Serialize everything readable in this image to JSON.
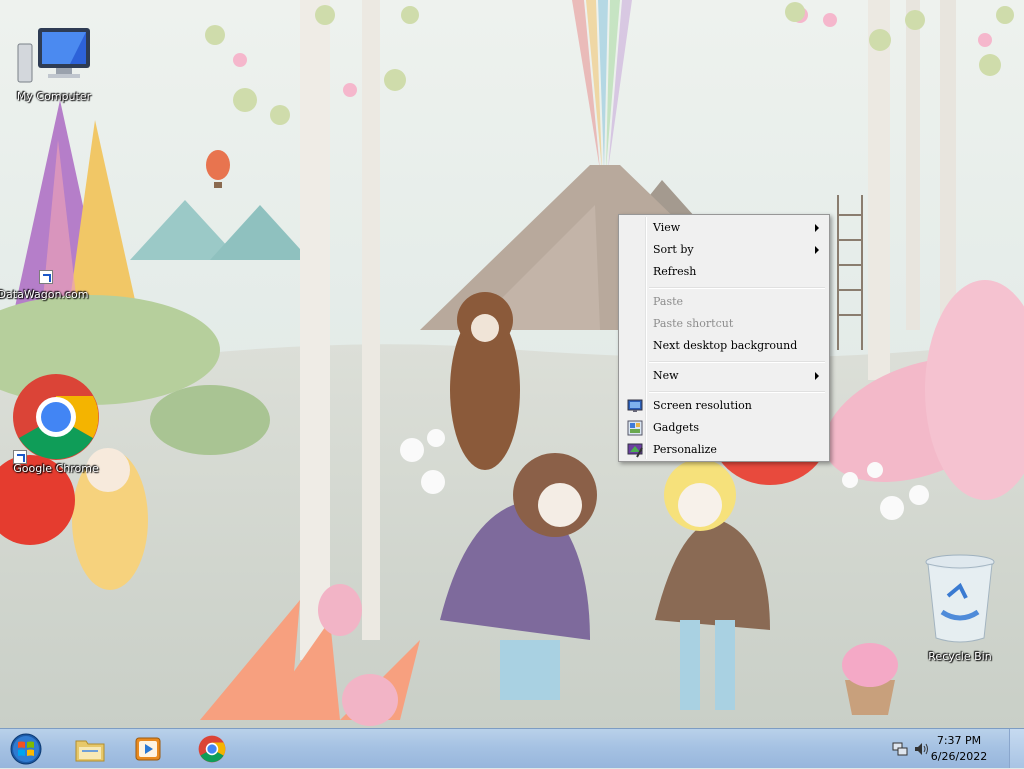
{
  "desktop": {
    "icons": [
      {
        "label": "My Computer",
        "icon": "computer-icon"
      },
      {
        "label": "DataWagon.com",
        "icon": "shortcut-icon"
      },
      {
        "label": "Google Chrome",
        "icon": "chrome-icon"
      },
      {
        "label": "Recycle Bin",
        "icon": "recycle-bin-icon"
      }
    ]
  },
  "context_menu": {
    "items": [
      {
        "label": "View",
        "submenu": true,
        "enabled": true
      },
      {
        "label": "Sort by",
        "submenu": true,
        "enabled": true
      },
      {
        "label": "Refresh",
        "enabled": true
      },
      {
        "label": "Paste",
        "enabled": false
      },
      {
        "label": "Paste shortcut",
        "enabled": false
      },
      {
        "label": "Next desktop background",
        "enabled": true
      },
      {
        "label": "New",
        "submenu": true,
        "enabled": true
      },
      {
        "label": "Screen resolution",
        "icon": "display-icon",
        "enabled": true
      },
      {
        "label": "Gadgets",
        "icon": "gadgets-icon",
        "enabled": true
      },
      {
        "label": "Personalize",
        "icon": "personalize-icon",
        "enabled": true
      }
    ]
  },
  "taskbar": {
    "pinned": [
      {
        "name": "Windows Explorer",
        "icon": "folder-icon"
      },
      {
        "name": "Windows Media Player",
        "icon": "media-player-icon"
      },
      {
        "name": "Google Chrome",
        "icon": "chrome-icon"
      }
    ],
    "tray": {
      "icons": [
        "network-icon",
        "volume-icon"
      ],
      "time": "7:37 PM",
      "date": "6/26/2022"
    }
  },
  "colors": {
    "taskbar": "#a6c2e3",
    "menu_background": "#f0f0f0",
    "chrome_red": "#db4437",
    "chrome_yellow": "#f4b400",
    "chrome_green": "#0f9d58",
    "chrome_blue": "#4285f4"
  }
}
